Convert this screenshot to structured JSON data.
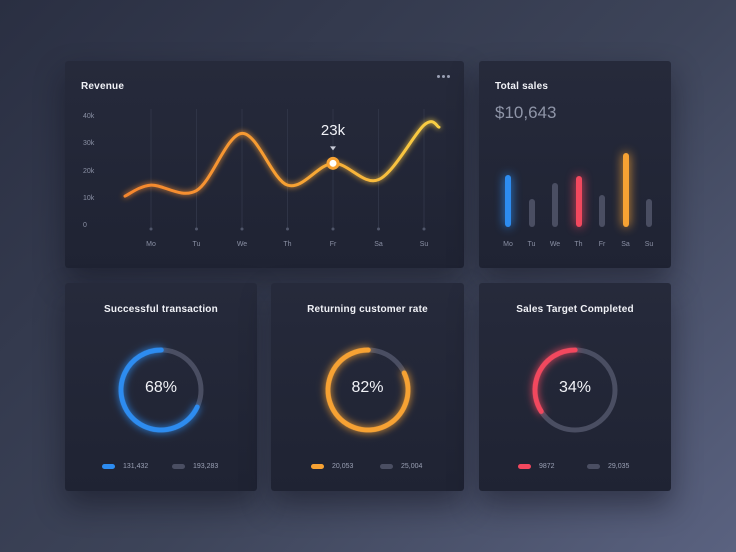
{
  "colors": {
    "blue": "#2d8cf0",
    "orange": "#f7a233",
    "yellow": "#f5c842",
    "red": "#f2485e",
    "track": "#4a4e62"
  },
  "revenue": {
    "title": "Revenue",
    "menu_icon": "more-horizontal-icon",
    "tooltip": "23k",
    "y_ticks": [
      "40k",
      "30k",
      "20k",
      "10k",
      "0"
    ],
    "days": [
      "Mo",
      "Tu",
      "We",
      "Th",
      "Fr",
      "Sa",
      "Su"
    ]
  },
  "total_sales": {
    "title": "Total sales",
    "value": "$10,643",
    "days": [
      "Mo",
      "Tu",
      "We",
      "Th",
      "Fr",
      "Sa",
      "Su"
    ]
  },
  "chart_data": [
    {
      "type": "line",
      "title": "Revenue",
      "x": [
        "Mo",
        "Tu",
        "We",
        "Th",
        "Fr",
        "Sa",
        "Su"
      ],
      "values": [
        15,
        13,
        34,
        15,
        23,
        17,
        37
      ],
      "ylim": [
        0,
        40
      ],
      "y_ticks": [
        "0",
        "10k",
        "20k",
        "30k",
        "40k"
      ],
      "highlight": {
        "x": "Fr",
        "label": "23k"
      },
      "grid": false
    },
    {
      "type": "bar",
      "title": "Total sales",
      "categories": [
        "Mo",
        "Tu",
        "We",
        "Th",
        "Fr",
        "Sa",
        "Su"
      ],
      "values": [
        60,
        33,
        51,
        59,
        37,
        86,
        33
      ],
      "bar_colors": [
        "blue",
        "track",
        "track",
        "red",
        "track",
        "orange",
        "track"
      ]
    }
  ],
  "donuts": [
    {
      "title": "Successful transaction",
      "percent_label": "68%",
      "percent": 68,
      "color": "#2d8cf0",
      "legend": [
        "131,432",
        "193,283"
      ]
    },
    {
      "title": "Returning customer rate",
      "percent_label": "82%",
      "percent": 82,
      "color": "#f7a233",
      "legend": [
        "20,053",
        "25,004"
      ]
    },
    {
      "title": "Sales Target Completed",
      "percent_label": "34%",
      "percent": 34,
      "color": "#f2485e",
      "legend": [
        "9872",
        "29,035"
      ]
    }
  ]
}
